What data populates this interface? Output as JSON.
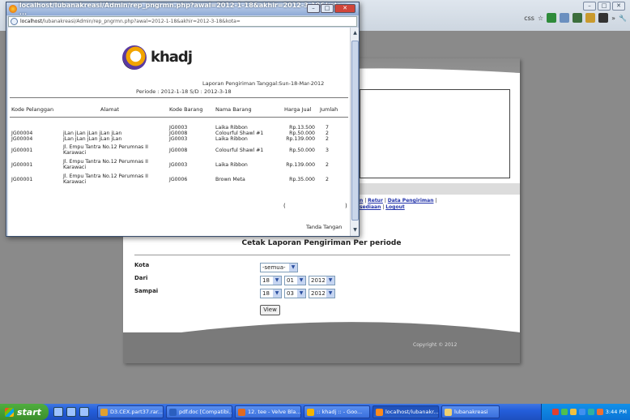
{
  "background_browser": {
    "toolbar_labels": [
      "css",
      "»"
    ],
    "nav_links_line1": [
      "n",
      "Retur",
      "Data Pengiriman"
    ],
    "nav_links_line2": [
      "sediaan",
      "Logout"
    ],
    "form": {
      "heading": "Cetak Laporan Pengiriman Per periode",
      "kota_label": "Kota",
      "kota_value": "-semua-",
      "dari_label": "Dari",
      "dari_day": "18",
      "dari_month": "01",
      "dari_year": "2012",
      "sampai_label": "Sampai",
      "sampai_day": "18",
      "sampai_month": "03",
      "sampai_year": "2012",
      "view_button": "View"
    },
    "copyright": "Copyright © 2012"
  },
  "popup": {
    "title": "localhost/lubanakreasi/Admin/rep_pngrmn.php?awal=2012-1-18&akhir=2012-3-18&kota= - ...",
    "address_host": "localhost",
    "address_path": "/lubanakreasi/Admin/rep_pngrmn.php?awal=2012-1-18&akhir=2012-3-18&kota=",
    "report": {
      "logo_text": "khadj",
      "title": "Laporan Pengiriman",
      "date": "Tanggal:Sun-18-Mar-2012",
      "periode": "Periode : 2012-1-18 S/D : 2012-3-18",
      "columns": [
        "Kode Pelanggan",
        "Alamat",
        "Kode Barang",
        "Nama Barang",
        "Harga Jual",
        "Jumlah"
      ],
      "rows": [
        {
          "kode_pelanggan": "JG00004\nJG00004",
          "alamat": "jLan jLan jLan jLan jLan\njLan jLan jLan jLan jLan",
          "kode_barang": "JG0003\nJG0008\nJG0003",
          "nama_barang": "Laika Ribbon\nColourful Shawl #1\nLaika Ribbon",
          "harga": "Rp.13.500\nRp.50.000\nRp.139.000",
          "jumlah": "7\n2\n2"
        },
        {
          "kode_pelanggan": "JG00001",
          "alamat": "Jl. Empu Tantra No.12 Perumnas II\nKarawaci",
          "kode_barang": "JG0008",
          "nama_barang": "Colourful Shawl #1",
          "harga": "Rp.50.000",
          "jumlah": "3"
        },
        {
          "kode_pelanggan": "JG00001",
          "alamat": "Jl. Empu Tantra No.12 Perumnas II\nKarawaci",
          "kode_barang": "JG0003",
          "nama_barang": "Laika Ribbon",
          "harga": "Rp.139.000",
          "jumlah": "2"
        },
        {
          "kode_pelanggan": "JG00001",
          "alamat": "Jl. Empu Tantra No.12 Perumnas II\nKarawaci",
          "kode_barang": "JG0006",
          "nama_barang": "Brown Meta",
          "harga": "Rp.35.000",
          "jumlah": "2"
        }
      ],
      "sig_paren_open": "(",
      "sig_paren_close": ")",
      "signature_label": "Tanda Tangan"
    }
  },
  "taskbar": {
    "start_label": "start",
    "items": [
      "D3.CEX.part37.rar...",
      "pdf.doc [Compatibi...",
      "12. tee - Velve Bla...",
      ":: khadj :: - Goo...",
      "localhost/lubanakr...",
      "lubanakreasi"
    ],
    "clock": "3:44 PM"
  }
}
